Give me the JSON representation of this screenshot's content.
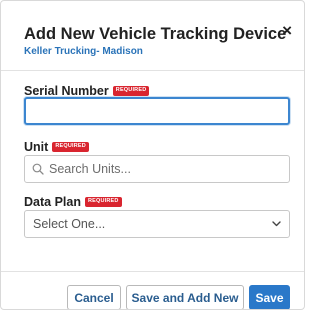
{
  "dialog": {
    "title": "Add New Vehicle Tracking Device",
    "subtitle": "Keller Trucking- Madison",
    "close_symbol": "×"
  },
  "fields": {
    "serial_number": {
      "label": "Serial Number",
      "required_badge": "REQUIRED",
      "value": ""
    },
    "unit": {
      "label": "Unit",
      "required_badge": "REQUIRED",
      "placeholder": "Search Units...",
      "icon": "search-icon"
    },
    "data_plan": {
      "label": "Data Plan",
      "required_badge": "REQUIRED",
      "selected": "Select One...",
      "icon": "chevron-down-icon"
    }
  },
  "buttons": {
    "cancel": "Cancel",
    "save_and_add_new": "Save and Add New",
    "save": "Save"
  },
  "colors": {
    "accent": "#2a78c9",
    "required": "#d9252f",
    "subtitle": "#2a73b8"
  }
}
